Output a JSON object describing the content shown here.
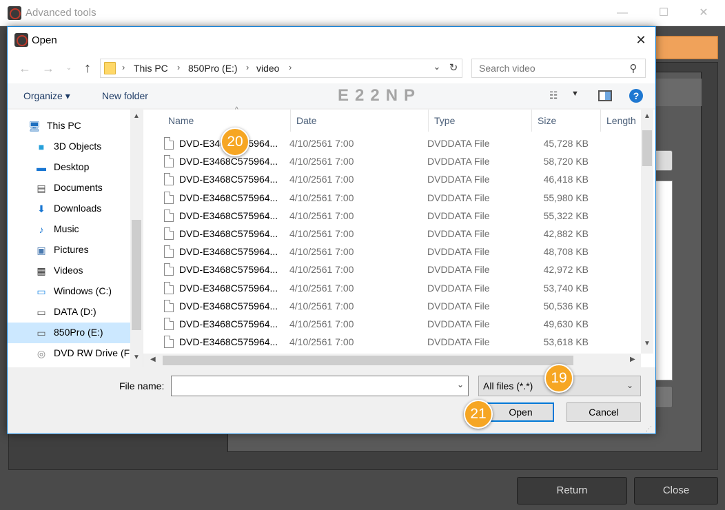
{
  "background_window": {
    "title": "Advanced tools",
    "min_glyph": "—",
    "max_glyph": "☐",
    "close_glyph": "✕",
    "return_label": "Return",
    "close_label": "Close"
  },
  "dialog": {
    "title": "Open",
    "close_glyph": "✕",
    "nav": {
      "back_glyph": "←",
      "forward_glyph": "→",
      "recent_glyph": "⌄",
      "up_glyph": "↑"
    },
    "breadcrumbs": [
      "This PC",
      "850Pro (E:)",
      "video"
    ],
    "breadcrumb_sep": "›",
    "address_dropdown_glyph": "⌄",
    "refresh_glyph": "↻",
    "search": {
      "placeholder": "Search video",
      "icon_glyph": "⚲"
    },
    "toolbar": {
      "organize_label": "Organize ▾",
      "new_folder_label": "New folder",
      "watermark": "E22NP",
      "view_icon_glyph": "☷",
      "view_dropdown_glyph": "▼",
      "help_glyph": "?"
    },
    "tree": [
      {
        "label": "This PC",
        "icon": "pc-icon",
        "glyph": "🖥",
        "color": "#1e6fbf",
        "selected": false
      },
      {
        "label": "3D Objects",
        "icon": "3d-objects-icon",
        "glyph": "■",
        "color": "#26a0da",
        "selected": false
      },
      {
        "label": "Desktop",
        "icon": "desktop-icon",
        "glyph": "▬",
        "color": "#1976d2",
        "selected": false
      },
      {
        "label": "Documents",
        "icon": "documents-icon",
        "glyph": "▤",
        "color": "#555555",
        "selected": false
      },
      {
        "label": "Downloads",
        "icon": "downloads-icon",
        "glyph": "⬇",
        "color": "#1976d2",
        "selected": false
      },
      {
        "label": "Music",
        "icon": "music-icon",
        "glyph": "♪",
        "color": "#1976d2",
        "selected": false
      },
      {
        "label": "Pictures",
        "icon": "pictures-icon",
        "glyph": "▣",
        "color": "#4a7ab0",
        "selected": false
      },
      {
        "label": "Videos",
        "icon": "videos-icon",
        "glyph": "▦",
        "color": "#333333",
        "selected": false
      },
      {
        "label": "Windows (C:)",
        "icon": "windows-drive-icon",
        "glyph": "▭",
        "color": "#1e88e5",
        "selected": false
      },
      {
        "label": "DATA (D:)",
        "icon": "drive-icon",
        "glyph": "▭",
        "color": "#555555",
        "selected": false
      },
      {
        "label": "850Pro (E:)",
        "icon": "drive-icon",
        "glyph": "▭",
        "color": "#555555",
        "selected": true
      },
      {
        "label": "DVD RW Drive (F",
        "icon": "dvd-drive-icon",
        "glyph": "◎",
        "color": "#888888",
        "selected": false
      }
    ],
    "columns": [
      "Name",
      "Date",
      "Type",
      "Size",
      "Length"
    ],
    "sort_glyph": "^",
    "files": [
      {
        "name": "DVD-E3468C575964...",
        "date": "4/10/2561 7:00",
        "type": "DVDDATA File",
        "size": "45,728 KB"
      },
      {
        "name": "DVD-E3468C575964...",
        "date": "4/10/2561 7:00",
        "type": "DVDDATA File",
        "size": "58,720 KB"
      },
      {
        "name": "DVD-E3468C575964...",
        "date": "4/10/2561 7:00",
        "type": "DVDDATA File",
        "size": "46,418 KB"
      },
      {
        "name": "DVD-E3468C575964...",
        "date": "4/10/2561 7:00",
        "type": "DVDDATA File",
        "size": "55,980 KB"
      },
      {
        "name": "DVD-E3468C575964...",
        "date": "4/10/2561 7:00",
        "type": "DVDDATA File",
        "size": "55,322 KB"
      },
      {
        "name": "DVD-E3468C575964...",
        "date": "4/10/2561 7:00",
        "type": "DVDDATA File",
        "size": "42,882 KB"
      },
      {
        "name": "DVD-E3468C575964...",
        "date": "4/10/2561 7:00",
        "type": "DVDDATA File",
        "size": "48,708 KB"
      },
      {
        "name": "DVD-E3468C575964...",
        "date": "4/10/2561 7:00",
        "type": "DVDDATA File",
        "size": "42,972 KB"
      },
      {
        "name": "DVD-E3468C575964...",
        "date": "4/10/2561 7:00",
        "type": "DVDDATA File",
        "size": "53,740 KB"
      },
      {
        "name": "DVD-E3468C575964...",
        "date": "4/10/2561 7:00",
        "type": "DVDDATA File",
        "size": "50,536 KB"
      },
      {
        "name": "DVD-E3468C575964...",
        "date": "4/10/2561 7:00",
        "type": "DVDDATA File",
        "size": "49,630 KB"
      },
      {
        "name": "DVD-E3468C575964...",
        "date": "4/10/2561 7:00",
        "type": "DVDDATA File",
        "size": "53,618 KB"
      }
    ],
    "scroll": {
      "up": "▲",
      "down": "▼",
      "left": "◀",
      "right": "▶"
    },
    "filename": {
      "label": "File name:",
      "value": "",
      "dropdown_glyph": "⌄"
    },
    "filetype": {
      "value": "All files (*.*)",
      "dropdown_glyph": "⌄"
    },
    "open_label": "Open",
    "cancel_label": "Cancel",
    "grip_glyph": "⋰"
  },
  "callouts": {
    "c19": "19",
    "c20": "20",
    "c21": "21"
  },
  "colors": {
    "accent_orange": "#f6a623",
    "selection_blue": "#cce8ff",
    "focus_blue": "#0078d7"
  }
}
